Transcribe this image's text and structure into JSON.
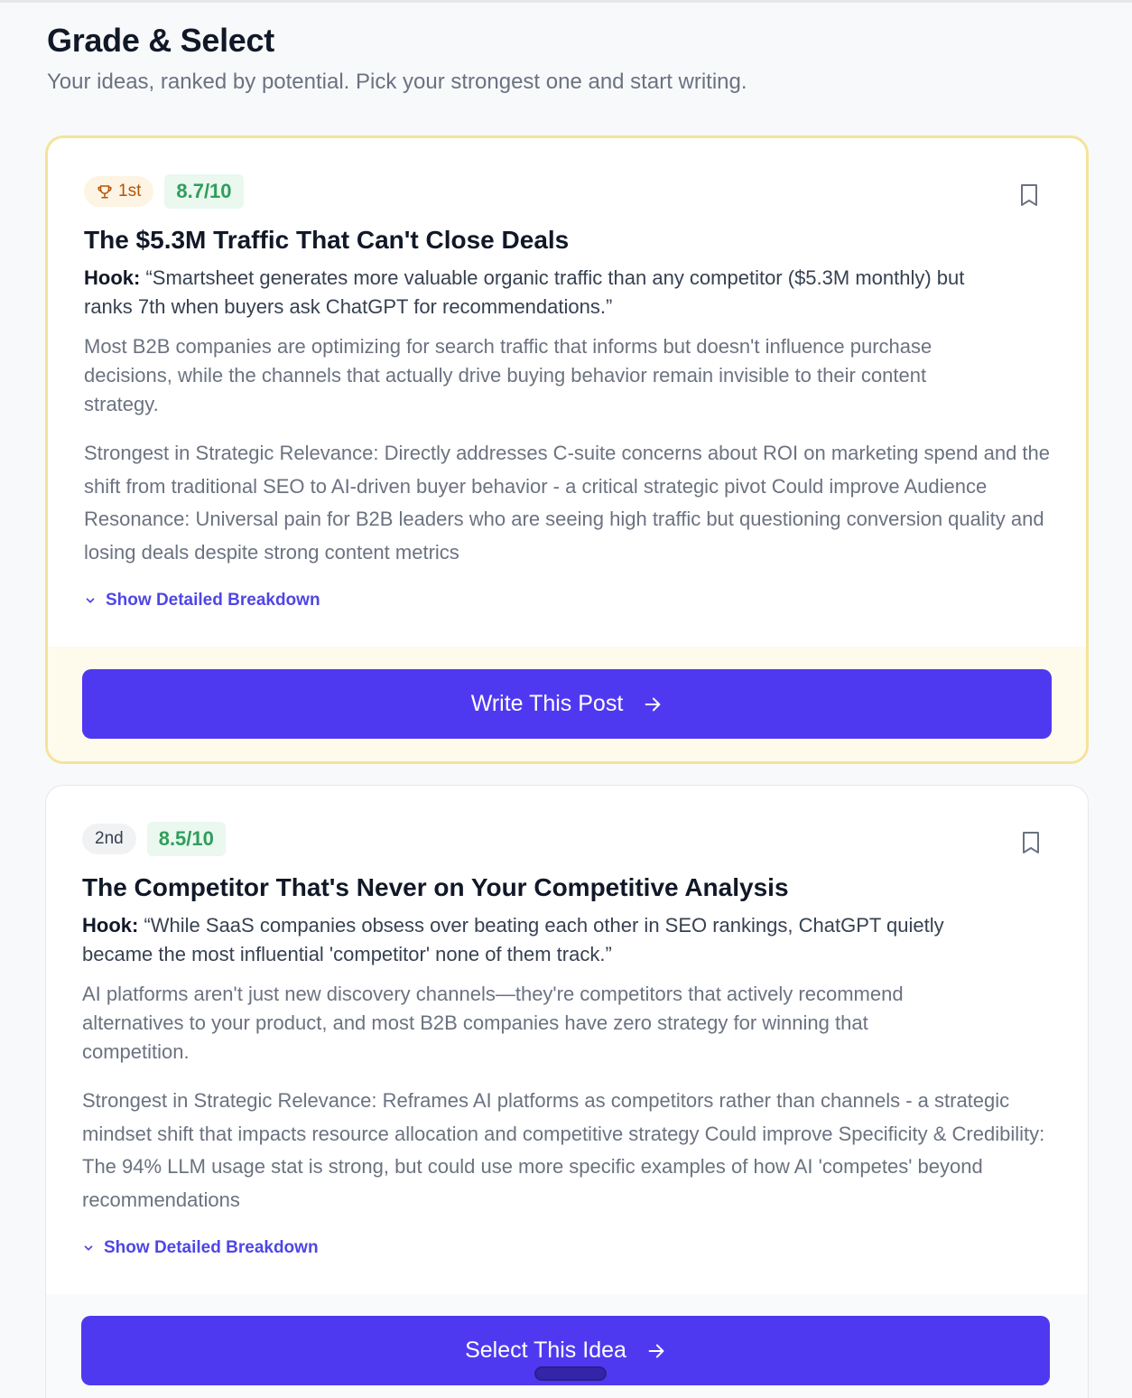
{
  "header": {
    "title": "Grade & Select",
    "subtitle": "Your ideas, ranked by potential. Pick your strongest one and start writing."
  },
  "ideas": [
    {
      "rank": "1st",
      "rank_icon": "trophy-icon",
      "score": "8.7/10",
      "title": "The $5.3M Traffic That Can't Close Deals",
      "hook_label": "Hook:",
      "hook": "“Smartsheet generates more valuable organic traffic than any competitor ($5.3M monthly) but ranks 7th when buyers ask ChatGPT for recommendations.”",
      "description": "Most B2B companies are optimizing for search traffic that informs but doesn't influence purchase decisions, while the channels that actually drive buying behavior remain invisible to their content strategy.",
      "analysis": "Strongest in Strategic Relevance: Directly addresses C-suite concerns about ROI on marketing spend and the shift from traditional SEO to AI-driven buyer behavior - a critical strategic pivot Could improve Audience Resonance: Universal pain for B2B leaders who are seeing high traffic but questioning conversion quality and losing deals despite strong content metrics",
      "toggle_label": "Show Detailed Breakdown",
      "cta_label": "Write This Post"
    },
    {
      "rank": "2nd",
      "score": "8.5/10",
      "title": "The Competitor That's Never on Your Competitive Analysis",
      "hook_label": "Hook:",
      "hook": "“While SaaS companies obsess over beating each other in SEO rankings, ChatGPT quietly became the most influential 'competitor' none of them track.”",
      "description": "AI platforms aren't just new discovery channels—they're competitors that actively recommend alternatives to your product, and most B2B companies have zero strategy for winning that competition.",
      "analysis": "Strongest in Strategic Relevance: Reframes AI platforms as competitors rather than channels - a strategic mindset shift that impacts resource allocation and competitive strategy Could improve Specificity & Credibility: The 94% LLM usage stat is strong, but could use more specific examples of how AI 'competes' beyond recommendations",
      "toggle_label": "Show Detailed Breakdown",
      "cta_label": "Select This Idea"
    }
  ],
  "colors": {
    "accent": "#4f39f0",
    "link": "#4f46e5",
    "score_text": "#2f9e5b",
    "score_bg": "#eaf8ef",
    "winner_border": "#f5e39a",
    "winner_footer_bg": "#fefbec"
  }
}
